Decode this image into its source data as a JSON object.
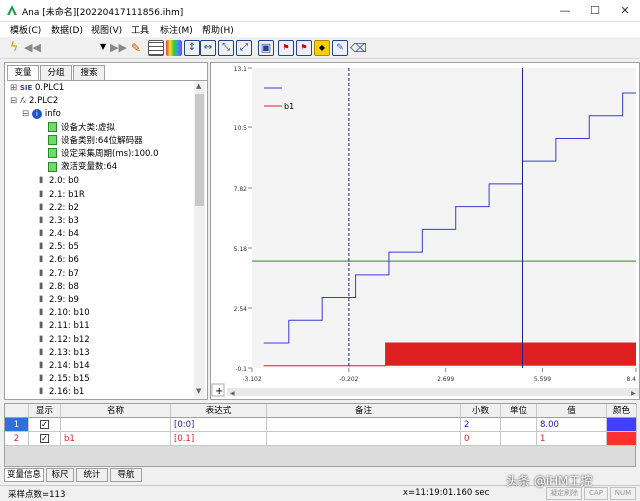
{
  "window": {
    "title": "Ana  [未命名][20220417111856.ihm]",
    "logo": "A"
  },
  "menu": [
    "模板(C)",
    "数据(D)",
    "视图(V)",
    "工具",
    "标注(M)",
    "帮助(H)"
  ],
  "toolbar": {
    "icons": [
      "refresh-icon",
      "back-icon",
      "dropdown-icon",
      "forward-icon",
      "pen-icon",
      "grid-icon",
      "color-bar-icon",
      "fit-vertical-icon",
      "fit-horizontal-icon",
      "zoom-in-icon",
      "zoom-out-icon",
      "save-icon",
      "tag-icon",
      "tag-add-icon",
      "tag-yellow-icon",
      "tag-edit-icon",
      "eraser-icon"
    ]
  },
  "left_tabs": [
    "变量",
    "分组",
    "搜索"
  ],
  "tree": {
    "plc1": "0.PLC1",
    "plc1_prefix": "SIE",
    "plc2": "2.PLC2",
    "info": "info",
    "info_items": [
      "设备大类:虚拟",
      "设备类别:64位解码器",
      "设定采集周期(ms):100.0",
      "激活变量数:64"
    ],
    "vars": [
      "2.0: b0",
      "2.1: b1R",
      "2.2: b2",
      "2.3: b3",
      "2.4: b4",
      "2.5: b5",
      "2.6: b6",
      "2.7: b7",
      "2.8: b8",
      "2.9: b9",
      "2.10: b10",
      "2.11: b11",
      "2.12: b12",
      "2.13: b13",
      "2.14: b14",
      "2.15: b15",
      "2.16: b1"
    ]
  },
  "chart_data": {
    "type": "line",
    "title": "",
    "xlabel": "",
    "ylabel": "",
    "ylim": [
      -0.1,
      13.1
    ],
    "xlim": [
      -3.102,
      8.4
    ],
    "y_ticks": [
      "13.1",
      "10.5",
      "7.82",
      "5.18",
      "2.54",
      "-0.1"
    ],
    "x_ticks": [
      "-3.102",
      "-0.202",
      "2.699",
      "5.599",
      "8.4"
    ],
    "legend": [
      {
        "name": "",
        "color": "#3a3ad0"
      },
      {
        "name": "b1",
        "color": "#e02020"
      }
    ],
    "series": [
      {
        "name": "",
        "color": "#3a3ad0",
        "style": "step",
        "x": [
          -2.75,
          -2.0,
          -1.0,
          0.0,
          1.0,
          2.0,
          3.0,
          4.0,
          5.0,
          6.0,
          7.0,
          8.0,
          8.4
        ],
        "values": [
          1.0,
          2.0,
          3.0,
          4.0,
          5.0,
          6.0,
          7.0,
          8.0,
          9.0,
          10.0,
          11.0,
          12.0,
          12.0
        ]
      },
      {
        "name": "b1",
        "color": "#e02020",
        "style": "fill",
        "x": [
          -2.75,
          0.7,
          0.9,
          8.4
        ],
        "values": [
          0,
          0,
          1,
          1
        ]
      }
    ],
    "hline": {
      "y": 4.6,
      "color": "#2a8a2a"
    },
    "cursors": [
      {
        "x": -0.2,
        "style": "dashed"
      },
      {
        "x": 5.0,
        "style": "solid"
      }
    ],
    "grid": false
  },
  "table": {
    "headers": [
      "",
      "显示",
      "名称",
      "表达式",
      "备注",
      "小数",
      "单位",
      "值",
      "颜色"
    ],
    "rows": [
      {
        "idx": "1",
        "name": "",
        "expr": "[0:0]",
        "note": "",
        "dec": "2",
        "unit": "",
        "value": "8.00",
        "color": "#4040ff"
      },
      {
        "idx": "2",
        "name": "b1",
        "expr": "[0.1]",
        "note": "",
        "dec": "0",
        "unit": "",
        "value": "1",
        "color": "#ff3030"
      }
    ]
  },
  "bottom_tabs": [
    "变量信息",
    "标尺",
    "统计",
    "导航"
  ],
  "status": {
    "samples": "采样点数=113",
    "cursor": "x=11:19:01.160 sec",
    "watermark": "头条 @iHM工控",
    "indicators": [
      "凝定刷除",
      "CAP",
      "NUM"
    ]
  }
}
